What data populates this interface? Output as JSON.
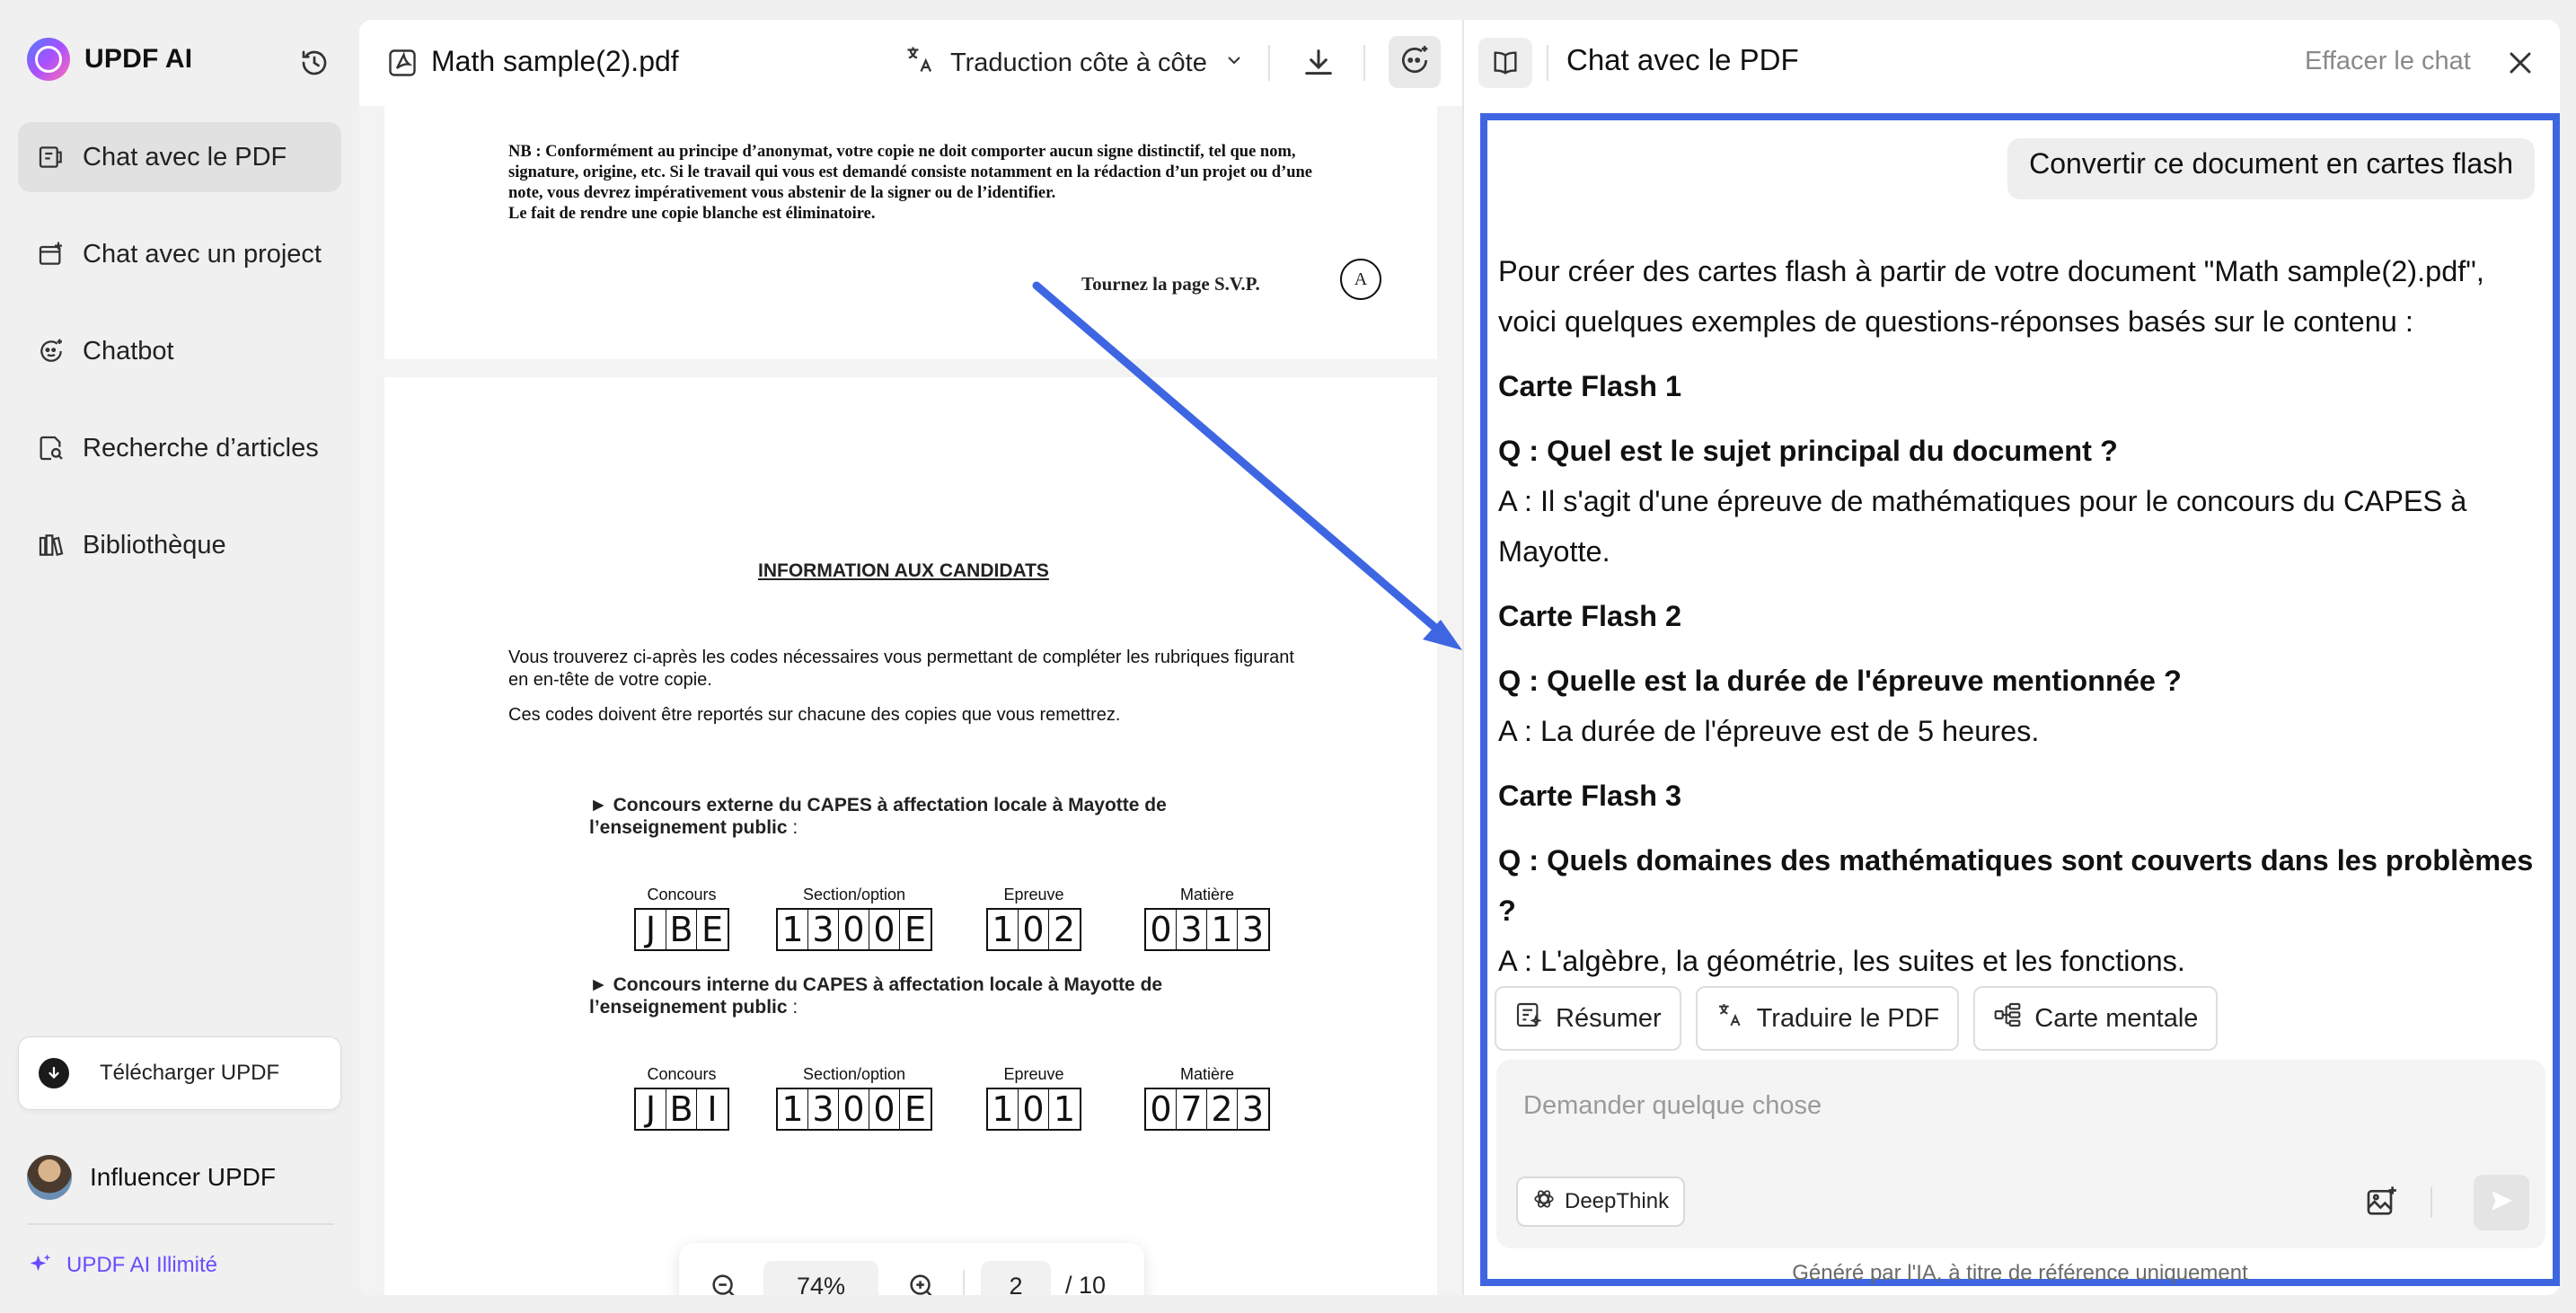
{
  "brand": {
    "name": "UPDF AI"
  },
  "sidebar": {
    "items": [
      {
        "label": "Chat avec le PDF",
        "icon": "chat-pdf-icon"
      },
      {
        "label": "Chat avec un project",
        "icon": "chat-project-icon"
      },
      {
        "label": "Chatbot",
        "icon": "chatbot-icon"
      },
      {
        "label": "Recherche d’articles",
        "icon": "article-search-icon"
      },
      {
        "label": "Bibliothèque",
        "icon": "library-icon"
      }
    ],
    "download_label": "Télécharger UPDF",
    "user_name": "Influencer UPDF",
    "unlimited_label": "UPDF AI Illimité"
  },
  "pdf": {
    "filename": "Math sample(2).pdf",
    "translate_mode": "Traduction côte à côte",
    "page1": {
      "nb_text": "NB : Conformément au principe d’anonymat, votre copie ne doit comporter aucun signe distinctif, tel que nom, signature, origine, etc. Si le travail qui vous est demandé consiste notamment en la rédaction d’un projet ou d’une note, vous devrez impérativement vous abstenir de la signer ou de l’identifier.",
      "nb_line2": "Le fait de rendre une copie blanche est éliminatoire.",
      "tournez": "Tournez la page S.V.P.",
      "circle_letter": "A"
    },
    "page2": {
      "title": "INFORMATION AUX CANDIDATS",
      "para1": "Vous trouverez ci-après les codes nécessaires vous permettant de compléter les rubriques figurant en en-tête de votre copie.",
      "para2": "Ces codes doivent être reportés sur chacune des copies que vous remettrez.",
      "concours1_title": "► Concours externe du CAPES à affectation locale à Mayotte de l’enseignement public",
      "concours2_title": "► Concours interne du CAPES à affectation locale à Mayotte de l’enseignement public",
      "colon": " :",
      "labels": {
        "concours": "Concours",
        "section": "Section/option",
        "epreuve": "Epreuve",
        "matiere": "Matière"
      },
      "codes1": {
        "concours": [
          "J",
          "B",
          "E"
        ],
        "section": [
          "1",
          "3",
          "0",
          "0",
          "E"
        ],
        "epreuve": [
          "1",
          "0",
          "2"
        ],
        "matiere": [
          "0",
          "3",
          "1",
          "3"
        ]
      },
      "codes2": {
        "concours": [
          "J",
          "B",
          "I"
        ],
        "section": [
          "1",
          "3",
          "0",
          "0",
          "E"
        ],
        "epreuve": [
          "1",
          "0",
          "1"
        ],
        "matiere": [
          "0",
          "7",
          "2",
          "3"
        ]
      }
    },
    "zoom": "74%",
    "page_current": "2",
    "page_total": "/ 10"
  },
  "chat": {
    "title": "Chat avec le PDF",
    "clear_label": "Effacer le chat",
    "user_message": "Convertir ce document en cartes flash",
    "answer_intro": "Pour créer des cartes flash à partir de votre document \"Math sample(2).pdf\", voici quelques exemples de questions-réponses basés sur le contenu :",
    "cards": [
      {
        "heading": "Carte Flash 1",
        "q": "Q : Quel est le sujet principal du document ?",
        "a": "A : Il s'agit d'une épreuve de mathématiques pour le concours du CAPES à Mayotte."
      },
      {
        "heading": "Carte Flash 2",
        "q": "Q : Quelle est la durée de l'épreuve mentionnée ?",
        "a": "A : La durée de l'épreuve est de 5 heures."
      },
      {
        "heading": "Carte Flash 3",
        "q": "Q : Quels domaines des mathématiques sont couverts dans les problèmes ?",
        "a": "A : L'algèbre, la géométrie, les suites et les fonctions."
      }
    ],
    "actions": [
      "Résumer",
      "Traduire le PDF",
      "Carte mentale"
    ],
    "input_placeholder": "Demander quelque chose",
    "deepthink_label": "DeepThink",
    "disclaimer": "Généré par l'IA, à titre de référence uniquement"
  },
  "colors": {
    "accent_frame": "#3e66e2",
    "brand_purple": "#6a4bff"
  }
}
